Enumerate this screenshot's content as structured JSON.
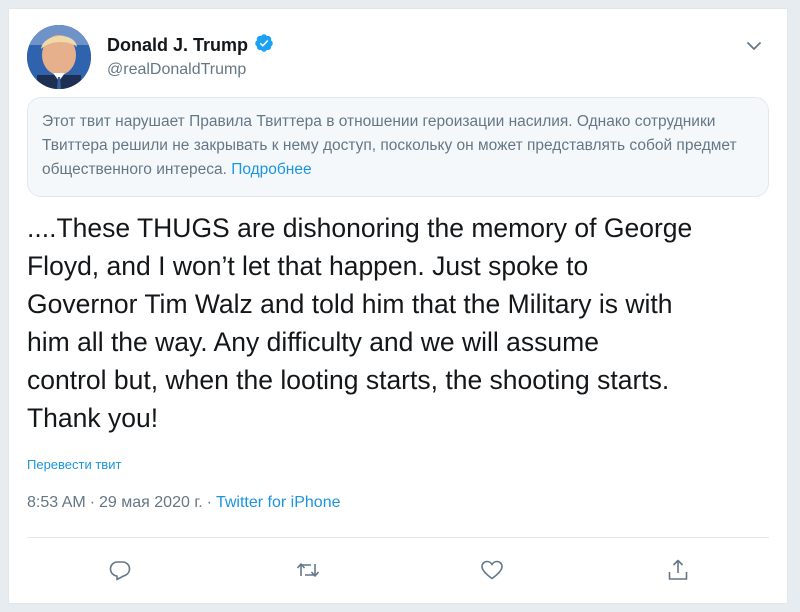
{
  "tweet": {
    "author": {
      "display_name": "Donald J. Trump",
      "handle": "@realDonaldTrump",
      "verified_icon": "verified-badge-icon"
    },
    "notice": {
      "text": "Этот твит нарушает Правила Твиттера в отношении героизации насилия. Однако сотрудники Твиттера решили не закрывать к нему доступ, поскольку он может представлять собой предмет общественного интереса.",
      "link_label": "Подробнее"
    },
    "body": "....These THUGS are dishonoring the memory of George\nFloyd, and I won’t let that happen. Just spoke to\nGovernor Tim Walz and told him that the Military is with\nhim all the way. Any difficulty and we will assume\ncontrol but, when the looting starts, the shooting starts.\nThank you!",
    "translate_label": "Перевести твит",
    "time": "8:53 AM",
    "separator": "·",
    "date": "29 мая 2020 г.",
    "source": "Twitter for iPhone"
  },
  "colors": {
    "accent": "#1b95e0",
    "verified": "#1da1f2",
    "muted": "#657786"
  },
  "icons": {
    "caret": "chevron-down-icon",
    "reply": "reply-icon",
    "retweet": "retweet-icon",
    "like": "heart-icon",
    "share": "share-icon"
  }
}
